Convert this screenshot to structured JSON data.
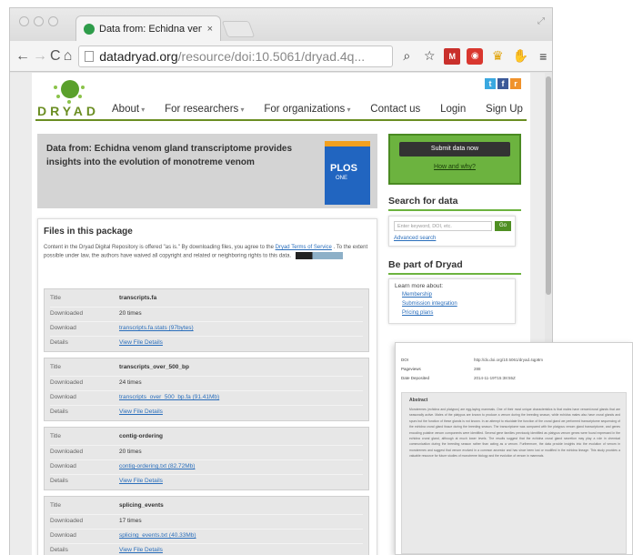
{
  "browser": {
    "tab_title": "Data from: Echidna venor",
    "tab_close": "×",
    "url_host": "datadryad.org",
    "url_path": "/resource/doi:10.5061/dryad.4q..."
  },
  "toolbar": {
    "back": "←",
    "forward": "→",
    "reload": "C",
    "home": "⌂",
    "search": "⌕",
    "star": "☆",
    "mail": "M",
    "stop": "◉",
    "crown": "♛",
    "hand": "✋",
    "menu": "≡"
  },
  "site": {
    "logo_text": "DRYAD",
    "social": {
      "twitter": "t",
      "facebook": "f",
      "rss": "r"
    },
    "nav": {
      "about": "About",
      "researchers": "For researchers",
      "organizations": "For organizations",
      "contact": "Contact us",
      "login": "Login",
      "signup": "Sign Up"
    }
  },
  "banner": {
    "title": "Data from: Echidna venom gland transcriptome provides insights into the evolution of monotreme venom",
    "journal": "PLOS",
    "journal_sub": "ONE"
  },
  "files": {
    "heading": "Files in this package",
    "terms_text": "Content in the Dryad Digital Repository is offered \"as is.\" By downloading files, you agree to the",
    "terms_link": "Dryad Terms of Service",
    "terms_rest": ". To the extent possible under law, the authors have waived all copyright and related or neighboring rights to this data.",
    "labels": {
      "title": "Title",
      "downloaded": "Downloaded",
      "download": "Download",
      "details": "Details"
    },
    "items": [
      {
        "title": "transcripts.fa",
        "downloaded": "20 times",
        "download": "transcripts.fa.stats (97bytes)",
        "details": "View File Details"
      },
      {
        "title": "transcripts_over_500_bp",
        "downloaded": "24 times",
        "download": "transcripts_over_500_bp.fa (91.41Mb)",
        "details": "View File Details"
      },
      {
        "title": "contig-ordering",
        "downloaded": "20 times",
        "download": "contig-ordering.txt (82.72Mb)",
        "details": "View File Details"
      },
      {
        "title": "splicing_events",
        "downloaded": "17 times",
        "download": "splicing_events.txt (40.33Mb)",
        "details": "View File Details"
      }
    ]
  },
  "sidebar": {
    "submit_button": "Submit data now",
    "submit_link": "How and why?",
    "search_heading": "Search for data",
    "search_placeholder": "Enter keyword, DOI, etc.",
    "search_go": "Go",
    "advanced_search": "Advanced search",
    "partof_heading": "Be part of Dryad",
    "learn_more": "Learn more about:",
    "links": [
      "Membership",
      "Submission integration",
      "Pricing plans"
    ]
  },
  "overlay": {
    "rows": [
      {
        "k": "DOI",
        "v": "http://dx.doi.org/10.5061/dryad.4qp8m"
      },
      {
        "k": "Pageviews",
        "v": "288"
      },
      {
        "k": "Date Deposited",
        "v": "2014-11-19T15:38:55Z"
      }
    ],
    "abstract_title": "Abstract",
    "abstract_text": "Monotremes (echidna and platypus) are egg-laying mammals. One of their most unique characteristics is that males have venom/crural glands that are seasonally active. Males of the platypus are known to produce a venom during the breeding season, while echidna males also have crural glands and spurs but the function of these glands is not known. In an attempt to elucidate the function of the crural gland we performed transcriptome sequencing of the echidna crural gland tissue during the breeding season. The transcriptome was compared with the platypus venom gland transcriptome, and genes encoding putative venom components were identified. Several gene families previously identified as platypus venom genes were found expressed in the echidna crural gland, although at much lower levels. The results suggest that the echidna crural gland secretion may play a role in chemical communication during the breeding season rather than acting as a venom. Furthermore, the data provide insights into the evolution of venom in monotremes and suggest that venom evolved in a common ancestor and has since been lost or modified in the echidna lineage. This study provides a valuable resource for future studies of monotreme biology and the evolution of venom in mammals."
  },
  "colors": {
    "dryad_green": "#6cb33f",
    "nav_line": "#6b8e23",
    "plos_blue": "#2165c0",
    "link_blue": "#2a6ebb"
  }
}
